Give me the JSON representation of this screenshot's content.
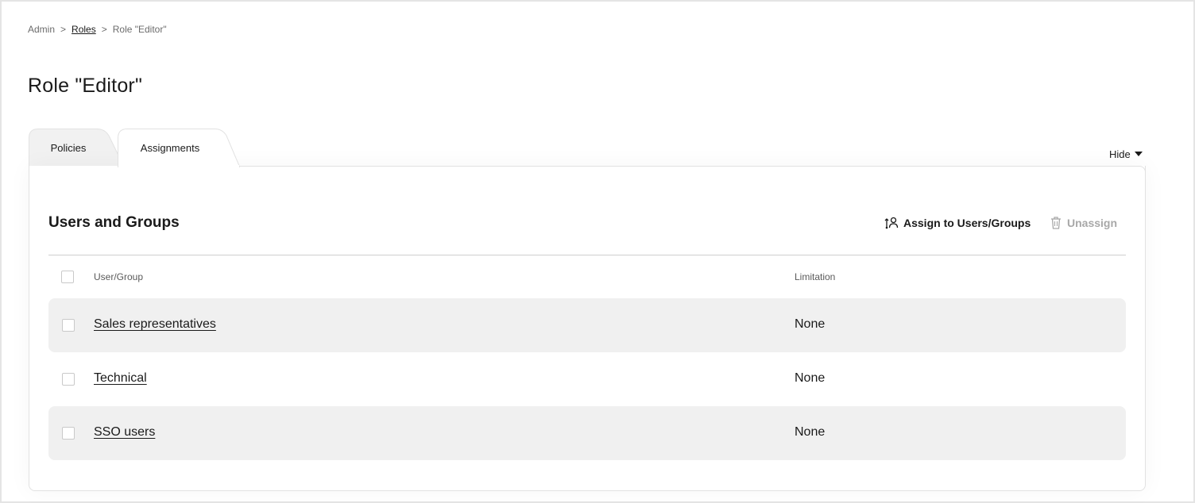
{
  "breadcrumb": {
    "items": [
      "Admin",
      "Roles",
      "Role \"Editor\""
    ],
    "separator": ">"
  },
  "page": {
    "title": "Role \"Editor\""
  },
  "tabs": [
    {
      "label": "Policies",
      "active": false
    },
    {
      "label": "Assignments",
      "active": true
    }
  ],
  "hide_toggle": {
    "label": "Hide"
  },
  "section": {
    "title": "Users and Groups",
    "assign_label": "Assign to Users/Groups",
    "unassign_label": "Unassign"
  },
  "table": {
    "columns": [
      "User/Group",
      "Limitation"
    ],
    "rows": [
      {
        "name": "Sales representatives",
        "limitation": "None"
      },
      {
        "name": "Technical",
        "limitation": "None"
      },
      {
        "name": "SSO users",
        "limitation": "None"
      }
    ]
  },
  "colors": {
    "text": "#1a1a1a",
    "muted": "#6b6b6b",
    "row_shade": "#f0f0f0",
    "tab_inactive": "#f1f1f1",
    "border": "#e2e2e2",
    "disabled": "#a8a8a8"
  },
  "icons": {
    "assign": "user-assign-icon",
    "unassign": "trash-icon",
    "hide": "caret-down-icon"
  }
}
